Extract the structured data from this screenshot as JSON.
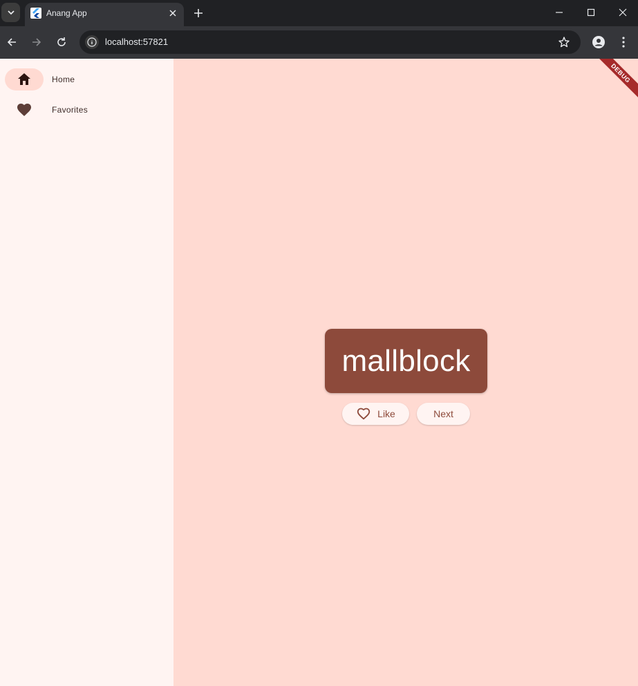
{
  "browser": {
    "tab_title": "Anang App",
    "url": "localhost:57821"
  },
  "rail": {
    "items": [
      {
        "label": "Home",
        "icon": "home-icon",
        "selected": true
      },
      {
        "label": "Favorites",
        "icon": "heart-icon",
        "selected": false
      }
    ]
  },
  "main": {
    "word": "mallblock",
    "like_label": "Like",
    "next_label": "Next"
  },
  "debug_banner": "DEBUG",
  "colors": {
    "primary": "#8d4a3b",
    "background": "#ffdad2",
    "rail_background": "#fff4f2"
  }
}
